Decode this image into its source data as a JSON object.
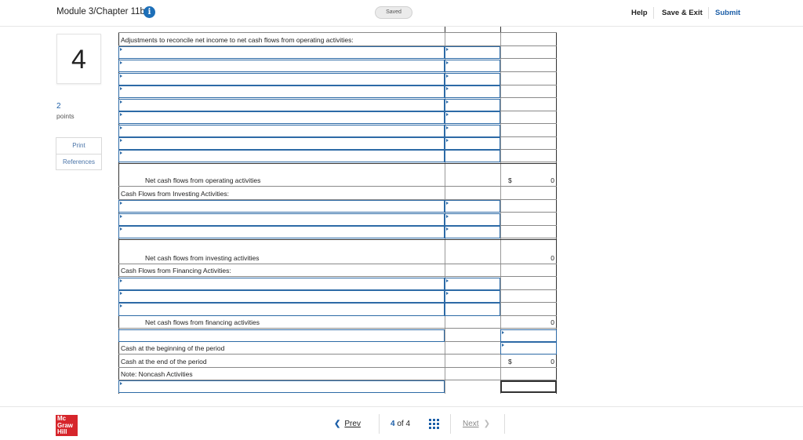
{
  "header": {
    "title": "Module 3/Chapter 11b",
    "info_glyph": "i",
    "saved_label": "Saved",
    "help_label": "Help",
    "save_exit_label": "Save & Exit",
    "submit_label": "Submit"
  },
  "question": {
    "number": "4",
    "points_value": "2",
    "points_label": "points",
    "print_label": "Print",
    "references_label": "References"
  },
  "worksheet": {
    "adjustments_label": "Adjustments to reconcile net income to net cash flows from operating activities:",
    "net_operating_label": "Net cash flows from operating activities",
    "net_operating_dollar": "$",
    "net_operating_value": "0",
    "investing_header": "Cash Flows from Investing Activities:",
    "net_investing_label": "Net cash flows from investing activities",
    "net_investing_value": "0",
    "financing_header": "Cash Flows from Financing Activities:",
    "net_financing_label": "Net cash flows from financing activities",
    "net_financing_value": "0",
    "cash_beginning_label": "Cash at the beginning of the period",
    "cash_end_label": "Cash at the end of the period",
    "cash_end_dollar": "$",
    "cash_end_value": "0",
    "noncash_label": "Note: Noncash Activities"
  },
  "footer": {
    "logo_lines": [
      "Mc",
      "Graw",
      "Hill"
    ],
    "prev_label": "Prev",
    "page_current": "4",
    "page_of": "of",
    "page_total": "4",
    "next_label": "Next"
  },
  "icons": {
    "info": "info-icon",
    "prev": "chevron-left-icon",
    "next": "chevron-right-icon",
    "grid": "grid-icon",
    "logo": "mcgraw-hill-logo"
  },
  "colors": {
    "accent": "#1d5fa8",
    "input_border": "#2d6aa6",
    "logo_red": "#d6252b"
  }
}
